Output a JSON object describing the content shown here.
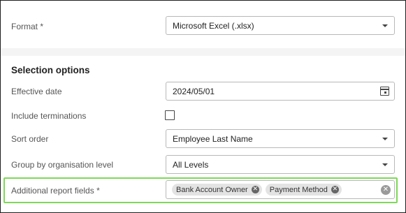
{
  "format": {
    "label": "Format *",
    "value": "Microsoft Excel (.xlsx)"
  },
  "selection": {
    "heading": "Selection options",
    "effective_date": {
      "label": "Effective date",
      "value": "2024/05/01"
    },
    "include_terminations": {
      "label": "Include terminations",
      "checked": false
    },
    "sort_order": {
      "label": "Sort order",
      "value": "Employee Last Name"
    },
    "group_by": {
      "label": "Group by organisation level",
      "value": "All Levels"
    },
    "additional_fields": {
      "label": "Additional report fields *",
      "tags": [
        {
          "text": "Bank Account Owner"
        },
        {
          "text": "Payment Method"
        }
      ]
    }
  },
  "icons": {
    "dropdown": "chevron-down-icon",
    "calendar": "calendar-icon",
    "remove_tag": "remove-tag-icon",
    "clear": "clear-all-icon"
  },
  "colors": {
    "highlight": "#7ed957",
    "tag_bg": "#e3e3e3"
  }
}
